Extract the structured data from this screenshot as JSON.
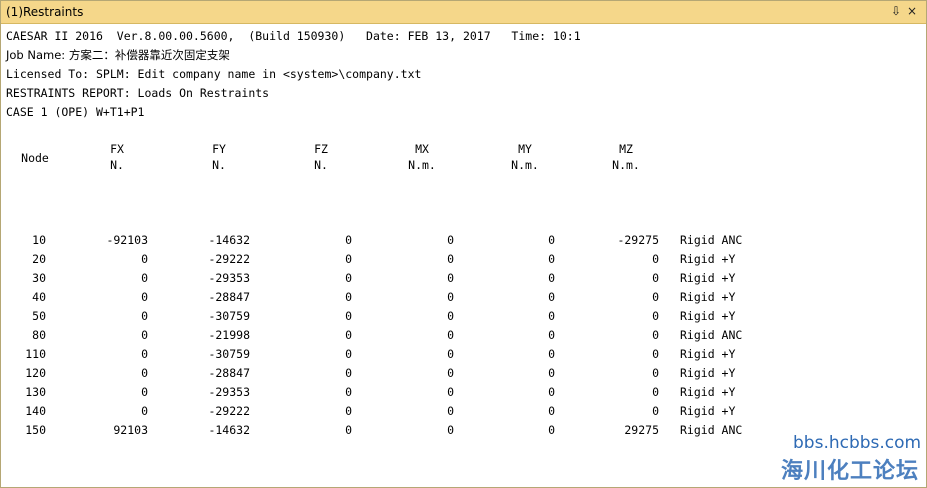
{
  "window": {
    "title": "(1)Restraints",
    "pin_glyph": " ⇩",
    "close_glyph": "×"
  },
  "header_lines": [
    "CAESAR II 2016  Ver.8.00.00.5600,  (Build 150930)   Date: FEB 13, 2017   Time: 10:1",
    "Job Name: 方案二：补偿器靠近次固定支架",
    "Licensed To: SPLM: Edit company name in <system>\\company.txt",
    "RESTRAINTS REPORT: Loads On Restraints",
    "CASE 1 (OPE) W+T1+P1"
  ],
  "table": {
    "columns": [
      {
        "name": "Node",
        "unit": ""
      },
      {
        "name": "FX",
        "unit": "N."
      },
      {
        "name": "FY",
        "unit": "N."
      },
      {
        "name": "FZ",
        "unit": "N."
      },
      {
        "name": "MX",
        "unit": "N.m."
      },
      {
        "name": "MY",
        "unit": "N.m."
      },
      {
        "name": "MZ",
        "unit": "N.m."
      }
    ],
    "rows": [
      {
        "node": "10",
        "fx": "-92103",
        "fy": "-14632",
        "fz": "0",
        "mx": "0",
        "my": "0",
        "mz": "-29275",
        "type": "Rigid ANC"
      },
      {
        "node": "20",
        "fx": "0",
        "fy": "-29222",
        "fz": "0",
        "mx": "0",
        "my": "0",
        "mz": "0",
        "type": "Rigid +Y"
      },
      {
        "node": "30",
        "fx": "0",
        "fy": "-29353",
        "fz": "0",
        "mx": "0",
        "my": "0",
        "mz": "0",
        "type": "Rigid +Y"
      },
      {
        "node": "40",
        "fx": "0",
        "fy": "-28847",
        "fz": "0",
        "mx": "0",
        "my": "0",
        "mz": "0",
        "type": "Rigid +Y"
      },
      {
        "node": "50",
        "fx": "0",
        "fy": "-30759",
        "fz": "0",
        "mx": "0",
        "my": "0",
        "mz": "0",
        "type": "Rigid +Y"
      },
      {
        "node": "80",
        "fx": "0",
        "fy": "-21998",
        "fz": "0",
        "mx": "0",
        "my": "0",
        "mz": "0",
        "type": "Rigid ANC"
      },
      {
        "node": "110",
        "fx": "0",
        "fy": "-30759",
        "fz": "0",
        "mx": "0",
        "my": "0",
        "mz": "0",
        "type": "Rigid +Y"
      },
      {
        "node": "120",
        "fx": "0",
        "fy": "-28847",
        "fz": "0",
        "mx": "0",
        "my": "0",
        "mz": "0",
        "type": "Rigid +Y"
      },
      {
        "node": "130",
        "fx": "0",
        "fy": "-29353",
        "fz": "0",
        "mx": "0",
        "my": "0",
        "mz": "0",
        "type": "Rigid +Y"
      },
      {
        "node": "140",
        "fx": "0",
        "fy": "-29222",
        "fz": "0",
        "mx": "0",
        "my": "0",
        "mz": "0",
        "type": "Rigid +Y"
      },
      {
        "node": "150",
        "fx": "92103",
        "fy": "-14632",
        "fz": "0",
        "mx": "0",
        "my": "0",
        "mz": "29275",
        "type": "Rigid ANC"
      }
    ]
  },
  "watermark": {
    "url": "bbs.hcbbs.com",
    "name": "海川化工论坛",
    "color": "#2e6ab4"
  },
  "colors": {
    "titlebar": "#f5d78a",
    "titlebar_border": "#d6b862"
  }
}
